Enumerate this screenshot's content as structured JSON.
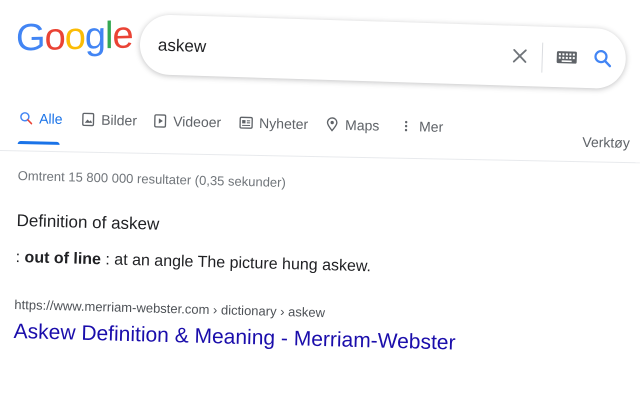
{
  "logo": {
    "letters": [
      "G",
      "o",
      "o",
      "g",
      "l",
      "e"
    ],
    "colors": [
      "#4285F4",
      "#EA4335",
      "#FBBC05",
      "#4285F4",
      "#34A853",
      "#EA4335"
    ]
  },
  "search": {
    "value": "askew",
    "icons": [
      "clear-icon",
      "keyboard-icon",
      "search-icon"
    ]
  },
  "tabs": {
    "items": [
      {
        "label": "Alle",
        "icon": "search-icon",
        "active": true
      },
      {
        "label": "Bilder",
        "icon": "image-icon"
      },
      {
        "label": "Videoer",
        "icon": "play-icon"
      },
      {
        "label": "Nyheter",
        "icon": "news-icon"
      },
      {
        "label": "Maps",
        "icon": "map-pin-icon"
      },
      {
        "label": "Mer",
        "icon": "more-vert-icon"
      }
    ],
    "tools": "Verktøy"
  },
  "results": {
    "stats": "Omtrent 15 800 000 resultater (0,35 sekunder)",
    "definition_heading": "Definition of askew",
    "definition": {
      "prefix": ": ",
      "bold": "out of line",
      "rest": " : at an angle The picture hung askew."
    },
    "first": {
      "cite": "https://www.merriam-webster.com › dictionary › askew",
      "title": "Askew Definition & Meaning - Merriam-Webster"
    }
  },
  "colors": {
    "accent": "#1a73e8",
    "link": "#1a0dab",
    "muted": "#70757a"
  }
}
